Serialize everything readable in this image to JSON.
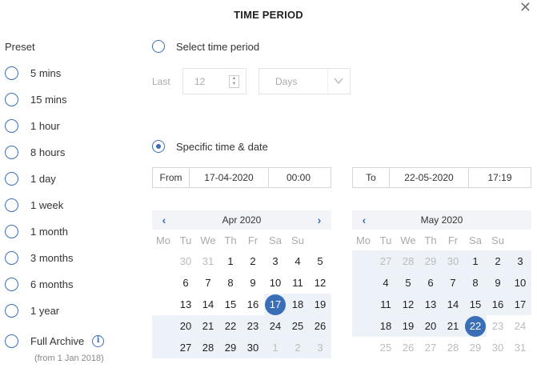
{
  "dialog": {
    "title": "TIME PERIOD",
    "close_glyph": "✕"
  },
  "presets": {
    "heading": "Preset",
    "items": [
      "5 mins",
      "15 mins",
      "1 hour",
      "8 hours",
      "1 day",
      "1 week",
      "1 month",
      "3 months",
      "6 months",
      "1 year"
    ],
    "full_archive": {
      "label": "Full Archive",
      "note": "(from 1 Jan 2018)",
      "info_glyph": "i"
    }
  },
  "select_period": {
    "label": "Select time period",
    "last_label": "Last",
    "amount_value": "12",
    "unit_value": "Days"
  },
  "specific": {
    "label": "Specific time & date",
    "from_label": "From",
    "from_date": "17-04-2020",
    "from_time": "00:00",
    "to_label": "To",
    "to_date": "22-05-2020",
    "to_time": "17:19"
  },
  "calendars": [
    {
      "month": "Apr 2020",
      "weekdays": [
        "Mo",
        "Tu",
        "We",
        "Th",
        "Fr",
        "Sa",
        "Su"
      ],
      "days": [
        {
          "d": "30",
          "o": true
        },
        {
          "d": "31",
          "o": true
        },
        {
          "d": "1"
        },
        {
          "d": "2"
        },
        {
          "d": "3"
        },
        {
          "d": "4"
        },
        {
          "d": "5"
        },
        {
          "d": "6"
        },
        {
          "d": "7"
        },
        {
          "d": "8"
        },
        {
          "d": "9"
        },
        {
          "d": "10"
        },
        {
          "d": "11"
        },
        {
          "d": "12"
        },
        {
          "d": "13"
        },
        {
          "d": "14"
        },
        {
          "d": "15"
        },
        {
          "d": "16"
        },
        {
          "d": "17",
          "s": true
        },
        {
          "d": "18",
          "r": true
        },
        {
          "d": "19",
          "r": true
        },
        {
          "d": "20",
          "r": true
        },
        {
          "d": "21",
          "r": true
        },
        {
          "d": "22",
          "r": true
        },
        {
          "d": "23",
          "r": true
        },
        {
          "d": "24",
          "r": true
        },
        {
          "d": "25",
          "r": true
        },
        {
          "d": "26",
          "r": true
        },
        {
          "d": "27",
          "r": true
        },
        {
          "d": "28",
          "r": true
        },
        {
          "d": "29",
          "r": true
        },
        {
          "d": "30",
          "r": true
        },
        {
          "d": "1",
          "o": true,
          "r": true
        },
        {
          "d": "2",
          "o": true,
          "r": true
        },
        {
          "d": "3",
          "o": true,
          "r": true
        }
      ]
    },
    {
      "month": "May 2020",
      "weekdays": [
        "Mo",
        "Tu",
        "We",
        "Th",
        "Fr",
        "Sa",
        "Su"
      ],
      "days": [
        {
          "d": "27",
          "o": true,
          "r": true
        },
        {
          "d": "28",
          "o": true,
          "r": true
        },
        {
          "d": "29",
          "o": true,
          "r": true
        },
        {
          "d": "30",
          "o": true,
          "r": true
        },
        {
          "d": "1",
          "r": true
        },
        {
          "d": "2",
          "r": true
        },
        {
          "d": "3",
          "r": true
        },
        {
          "d": "4",
          "r": true
        },
        {
          "d": "5",
          "r": true
        },
        {
          "d": "6",
          "r": true
        },
        {
          "d": "7",
          "r": true
        },
        {
          "d": "8",
          "r": true
        },
        {
          "d": "9",
          "r": true
        },
        {
          "d": "10",
          "r": true
        },
        {
          "d": "11",
          "r": true
        },
        {
          "d": "12",
          "r": true
        },
        {
          "d": "13",
          "r": true
        },
        {
          "d": "14",
          "r": true
        },
        {
          "d": "15",
          "r": true
        },
        {
          "d": "16",
          "r": true
        },
        {
          "d": "17",
          "r": true
        },
        {
          "d": "18",
          "r": true
        },
        {
          "d": "19",
          "r": true
        },
        {
          "d": "20",
          "r": true
        },
        {
          "d": "21",
          "r": true
        },
        {
          "d": "22",
          "s": true
        },
        {
          "d": "23",
          "o": true
        },
        {
          "d": "24",
          "o": true
        },
        {
          "d": "25",
          "o": true
        },
        {
          "d": "26",
          "o": true
        },
        {
          "d": "27",
          "o": true
        },
        {
          "d": "28",
          "o": true
        },
        {
          "d": "29",
          "o": true
        },
        {
          "d": "30",
          "o": true
        },
        {
          "d": "31",
          "o": true
        }
      ]
    }
  ],
  "colors": {
    "accent": "#3a6fb8",
    "range_bg": "#edf1f8",
    "muted": "#aaaaaa"
  }
}
